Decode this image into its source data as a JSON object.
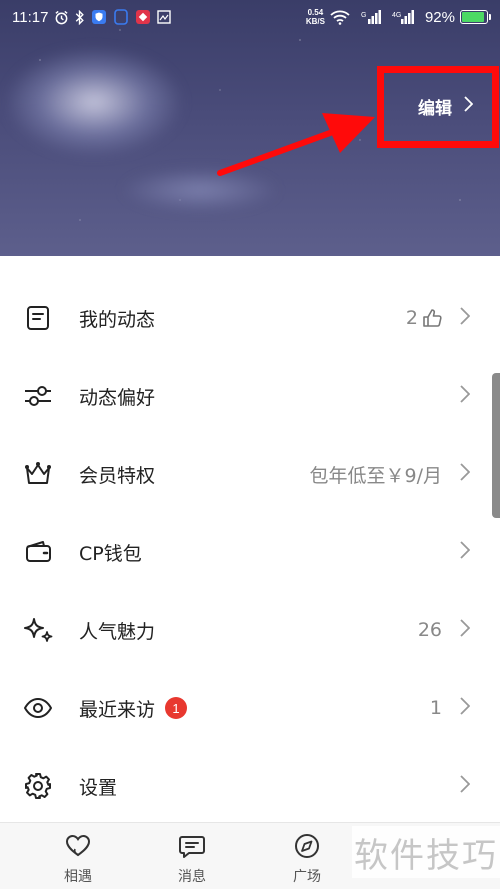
{
  "status_bar": {
    "time": "11:17",
    "net_speed_value": "0.54",
    "net_speed_unit": "KB/S",
    "battery_percent": "92%",
    "battery_level": 0.92,
    "icons": [
      "alarm-icon",
      "bluetooth-icon",
      "shield-app-icon",
      "app-icon",
      "app-icon-red",
      "image-icon",
      "wifi-icon",
      "signal-icon",
      "signal-4g-icon",
      "battery-icon"
    ]
  },
  "header": {
    "edit_label": "编辑",
    "highlight_color": "#ff0a0a"
  },
  "menu": {
    "items": [
      {
        "icon": "document-icon",
        "label": "我的动态",
        "value": "2",
        "value_icon": "thumbs-up-icon"
      },
      {
        "icon": "sliders-icon",
        "label": "动态偏好",
        "value": ""
      },
      {
        "icon": "crown-icon",
        "label": "会员特权",
        "value": "包年低至￥9/月"
      },
      {
        "icon": "wallet-icon",
        "label": "CP钱包",
        "value": ""
      },
      {
        "icon": "sparkle-icon",
        "label": "人气魅力",
        "value": "26"
      },
      {
        "icon": "eye-icon",
        "label": "最近来访",
        "badge": "1",
        "value": "1"
      },
      {
        "icon": "gear-icon",
        "label": "设置",
        "value": ""
      }
    ]
  },
  "bottom_nav": {
    "items": [
      {
        "icon": "heart-icon",
        "label": "相遇"
      },
      {
        "icon": "chat-icon",
        "label": "消息"
      },
      {
        "icon": "compass-icon",
        "label": "广场"
      }
    ]
  },
  "watermark": "软件技巧",
  "colors": {
    "badge": "#e8382f",
    "header_bg": "#4a4c7a",
    "battery_fill": "#4cd964"
  }
}
